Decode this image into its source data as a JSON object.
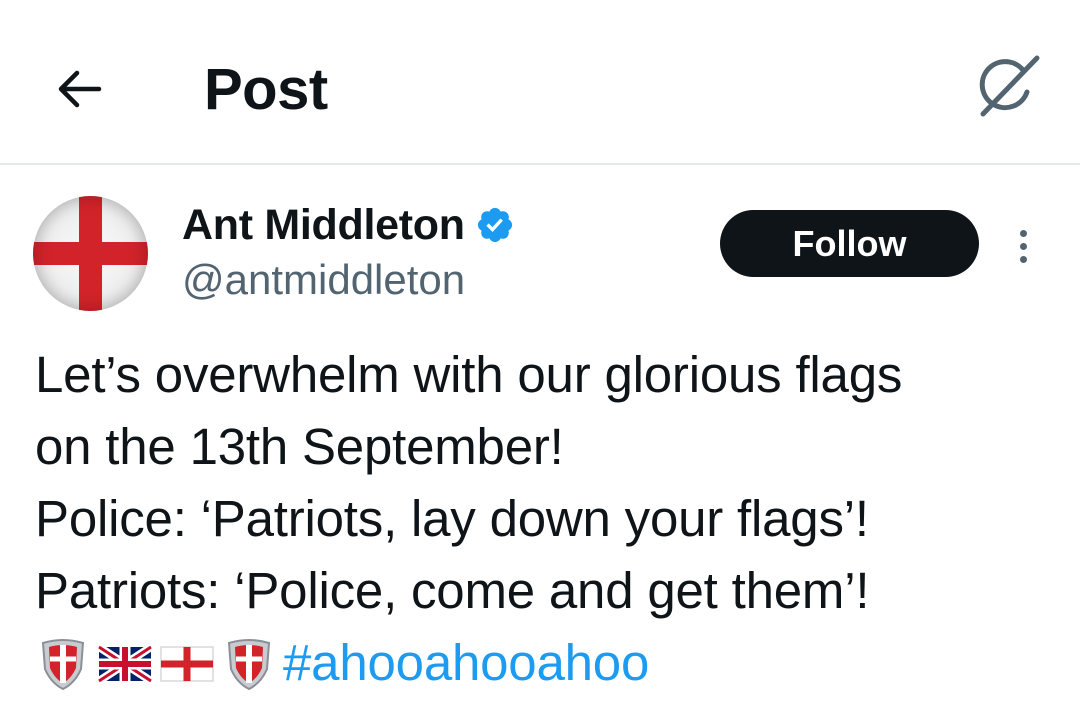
{
  "header": {
    "back_icon": "arrow-left-icon",
    "title": "Post",
    "grok_icon": "grok-icon"
  },
  "author": {
    "display_name": "Ant Middleton",
    "handle": "@antmiddleton",
    "verified_icon": "verified-badge-icon",
    "verified_color": "#1d9bf0",
    "avatar": "england-flag-avatar",
    "follow_label": "Follow",
    "more_icon": "more-vertical-icon"
  },
  "tweet": {
    "lines": [
      "Let’s overwhelm with our glorious flags",
      "on the 13th September!",
      "Police: ‘Patriots, lay down your flags’!",
      "Patriots: ‘Police, come and get them’!"
    ],
    "emojis": [
      "shield-emoji",
      "uk-flag-emoji",
      "england-flag-emoji",
      "shield-emoji"
    ],
    "hashtag": "#ahooahooahoo",
    "hashtag_color": "#1d9bf0"
  },
  "colors": {
    "text_primary": "#0f1419",
    "text_secondary": "#536471",
    "follow_bg": "#0f1419",
    "divider": "#e6e9ec"
  }
}
